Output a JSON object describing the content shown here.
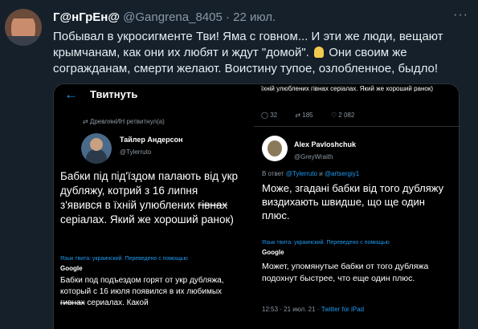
{
  "tweet": {
    "name": "Г@нГрЕн@",
    "handle": "@Gangrena_8405",
    "separator": "·",
    "date": "22 июл.",
    "more": "···",
    "text_part1": "Побывал в укросигменте Тви! Яма с говном... И эти же люди, вещают крымчанам, как они их любят и ждут \"домой\".",
    "text_part2": "Они своим же согражданам, смерти желают. Воистину тупое, озлобленное, быдло!"
  },
  "left_screenshot": {
    "back_arrow": "←",
    "title": "Твитнуть",
    "retweeted_by": "⇄  ДревлянИН ретвитнул(а)",
    "author_name": "Тайлер Андерсон",
    "author_handle": "@Tylerruto",
    "body_before_strike": "Бабки під під'їздом палають від укр дубляжу, котрий з 16 липня з'явився в їхній улюблених ",
    "body_strike": "гівнах",
    "body_after_strike": " серіалах. Який же хороший ранок)",
    "translation_label": "Язык твита: украинский. Переведено с помощью",
    "google": "Google",
    "translation_before": "Бабки под подъездом горят от укр дубляжа, который с 16 июля появился в их любимых ",
    "translation_strike": "гивнах",
    "translation_after": " сериалах. Какой"
  },
  "right_screenshot": {
    "prev_text": "їхній улюблених гівнах серіалах. Який же хороший ранок)",
    "stats": {
      "replies": "32",
      "retweets": "185",
      "likes": "2 082"
    },
    "author_name": "Alex Pavloshchuk",
    "author_handle": "@GreyWraith",
    "reply_prefix": "В ответ",
    "reply_to_1": "@Tylerruto",
    "reply_and": "и",
    "reply_to_2": "@artsergiy1",
    "body": "Може, згадані бабки від того дубляжу виздихають швидше, що ще один плюс.",
    "translation_label": "Язык твита: украинский. Переведено с помощью",
    "google": "Google",
    "translation": "Может, упомянутые бабки от того дубляжа подохнут быстрее, что еще один плюс.",
    "time": "12:53 · 21 июл. 21 ·",
    "source": "Twitter for iPad"
  },
  "colors": {
    "background": "#15202b",
    "accent": "#1d9bf0",
    "muted": "#8b98a5"
  }
}
